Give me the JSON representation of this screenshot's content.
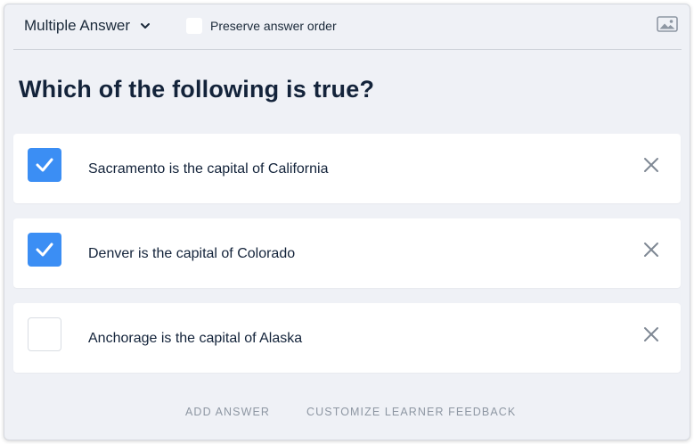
{
  "toolbar": {
    "question_type": "Multiple Answer",
    "type_icon": "chevron-down-icon",
    "preserve_label": "Preserve answer order",
    "preserve_checked": false,
    "image_icon": "image-icon"
  },
  "question": {
    "text": "Which of the following is true?"
  },
  "answers": [
    {
      "text": "Sacramento is the capital of California",
      "checked": true
    },
    {
      "text": "Denver is the capital of Colorado",
      "checked": true
    },
    {
      "text": "Anchorage is the capital of Alaska",
      "checked": false
    }
  ],
  "footer": {
    "add_answer": "ADD ANSWER",
    "customize_feedback": "CUSTOMIZE LEARNER FEEDBACK"
  },
  "colors": {
    "accent": "#3b8ef4",
    "background": "#eff1f6",
    "text": "#13233a",
    "muted": "#8e97a3"
  }
}
